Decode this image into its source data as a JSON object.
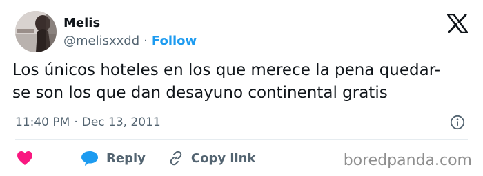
{
  "tweet": {
    "author_name": "Melis",
    "author_handle": "@melisxxdd",
    "separator": "·",
    "follow_label": "Follow",
    "text_lines": [
      "Los únicos hoteles en los que merece la pena quedar-",
      "se son los que dan desayuno continental gratis"
    ],
    "time": "11:40 PM",
    "date": "Dec 13, 2011"
  },
  "actions": {
    "like_icon": "heart-icon",
    "reply_label": "Reply",
    "reply_icon": "speech-bubble-icon",
    "copy_label": "Copy link",
    "copy_icon": "link-icon"
  },
  "branding": {
    "platform_logo": "x-logo-icon",
    "watermark": "boredpanda.com"
  },
  "colors": {
    "accent": "#1d9bf0",
    "heart": "#f91880",
    "text": "#0f1419",
    "muted": "#536471"
  }
}
